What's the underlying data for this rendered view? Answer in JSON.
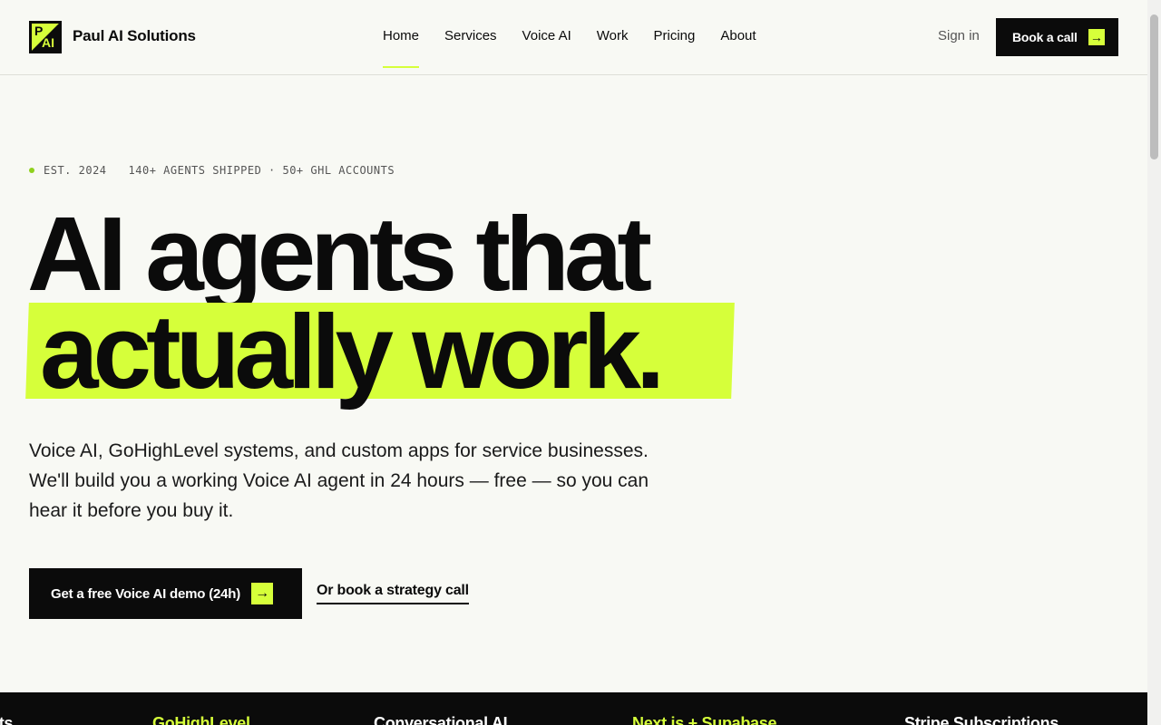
{
  "header": {
    "brand": "Paul AI Solutions",
    "logo_text_p": "P",
    "logo_text_ai": "AI",
    "nav": [
      "Home",
      "Services",
      "Voice AI",
      "Work",
      "Pricing",
      "About"
    ],
    "active_nav": "Home",
    "signin_label": "Sign in",
    "book_label": "Book a call",
    "arrow": "→"
  },
  "hero": {
    "eyebrow_est": "EST. 2024",
    "eyebrow_stats": "140+ AGENTS SHIPPED · 50+ GHL ACCOUNTS",
    "headline_line1": "AI agents that",
    "headline_line2": "actually work.",
    "subtitle": "Voice AI, GoHighLevel systems, and custom apps for service businesses. We'll build you a working Voice AI agent in 24 hours — free — so you can hear it before you buy it.",
    "cta_primary": "Get a free Voice AI demo (24h)",
    "cta_secondary": "Or book a strategy call"
  },
  "ticker": {
    "items": [
      "nts",
      "GoHighLevel",
      "Conversational AI",
      "Next.js + Supabase",
      "Stripe Subscriptions"
    ]
  },
  "colors": {
    "accent": "#d6ff3a",
    "ink": "#0b0b0b",
    "background": "#f8f9f4"
  }
}
